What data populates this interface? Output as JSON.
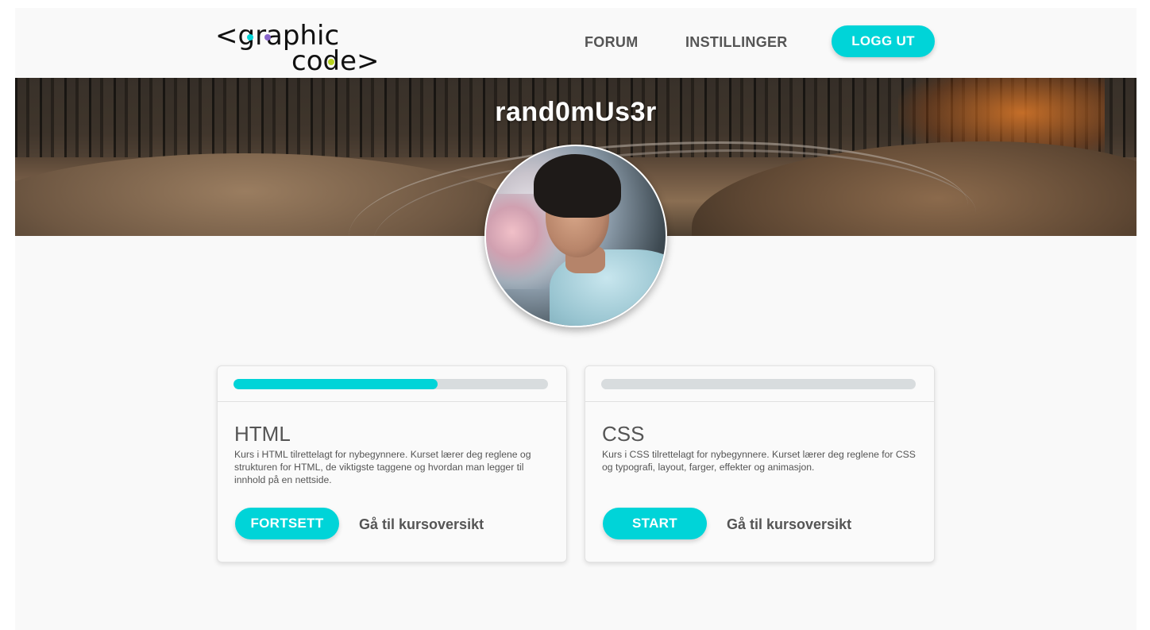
{
  "header": {
    "logo": {
      "text_top": "<graphic",
      "text_bottom": "code>",
      "dot_colors": [
        "#00d4d8",
        "#8a66cc",
        "#b7d31f"
      ]
    },
    "nav": [
      {
        "label": "FORUM"
      },
      {
        "label": "INSTILLINGER"
      }
    ],
    "logout_label": "LOGG UT"
  },
  "profile": {
    "username": "rand0mUs3r",
    "avatar": "profile-photo"
  },
  "courses": [
    {
      "title": "HTML",
      "description": "Kurs i HTML tilrettelagt for nybegynnere. Kurset lærer deg reglene og strukturen for HTML, de viktigste taggene og hvordan man legger til innhold på en nettside.",
      "progress": 0.65,
      "action_label": "FORTSETT",
      "overview_label": "Gå til kursoversikt"
    },
    {
      "title": "CSS",
      "description": "Kurs i CSS tilrettelagt for nybegynnere. Kurset lærer deg reglene for CSS og typografi, layout, farger, effekter og animasjon.",
      "progress": 0,
      "action_label": "START",
      "overview_label": "Gå til kursoversikt"
    }
  ],
  "colors": {
    "accent": "#00d4d8",
    "text": "#555555",
    "track": "#d8dcde"
  }
}
